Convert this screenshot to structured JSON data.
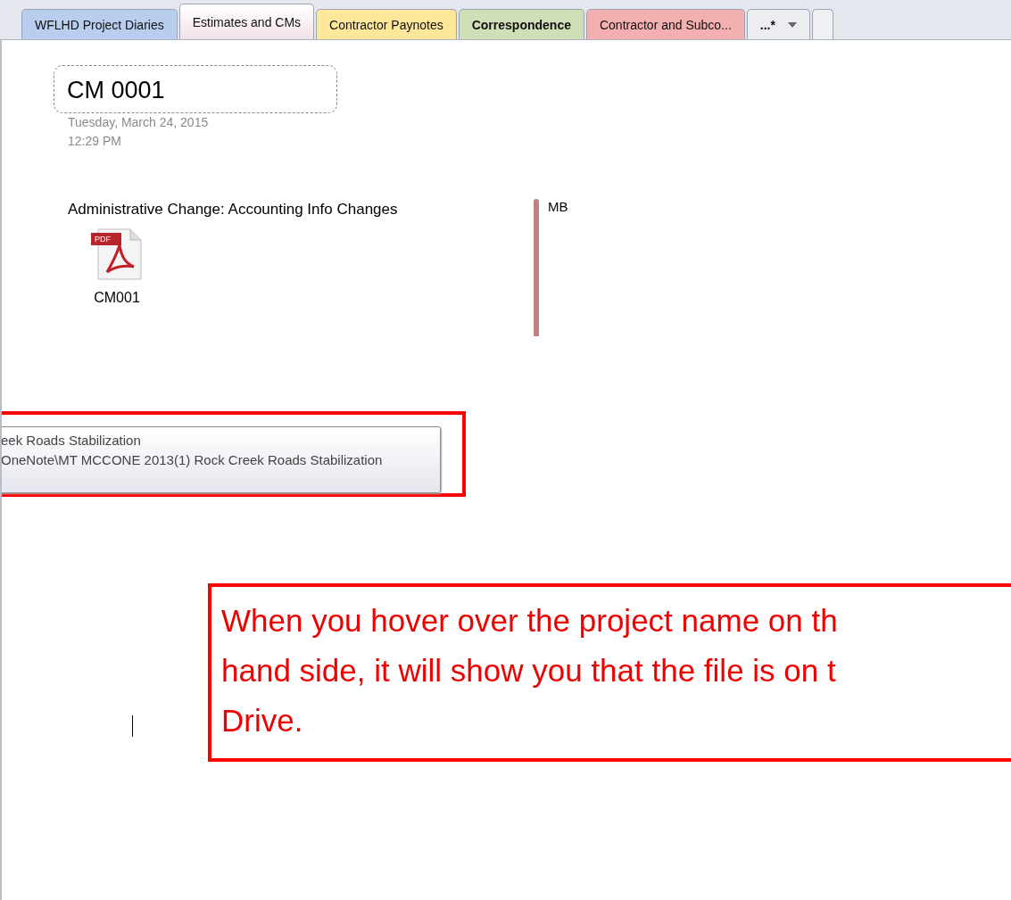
{
  "tabs": [
    {
      "label": "WFLHD Project Diaries",
      "selected": false,
      "color": "#b9cdee",
      "bold": false
    },
    {
      "label": "Estimates and CMs",
      "selected": true,
      "color": "#f3e1ea",
      "bold": false
    },
    {
      "label": "Contractor Paynotes",
      "selected": false,
      "color": "#fde79a",
      "bold": false
    },
    {
      "label": "Correspondence",
      "selected": false,
      "color": "#cfe0b8",
      "bold": true
    },
    {
      "label": "Contractor and Subco...",
      "selected": false,
      "color": "#f4b0b0",
      "bold": false
    }
  ],
  "more_tab": {
    "label": "...*"
  },
  "page": {
    "title": "CM 0001",
    "date": "Tuesday, March 24, 2015",
    "time": "12:29 PM",
    "heading": "Administrative Change: Accounting Info Changes",
    "attachment": {
      "name": "CM001",
      "badge": "PDF"
    },
    "author": {
      "initials": "MB",
      "color": "#c27f82"
    }
  },
  "tooltip": {
    "lines": [
      "eek Roads Stabilization",
      "OneNote\\MT MCCONE 2013(1) Rock Creek Roads Stabilization"
    ]
  },
  "annotation": {
    "lines": [
      "When you hover over the project name on th",
      "hand side, it will show you that the file is on t",
      "Drive."
    ]
  }
}
